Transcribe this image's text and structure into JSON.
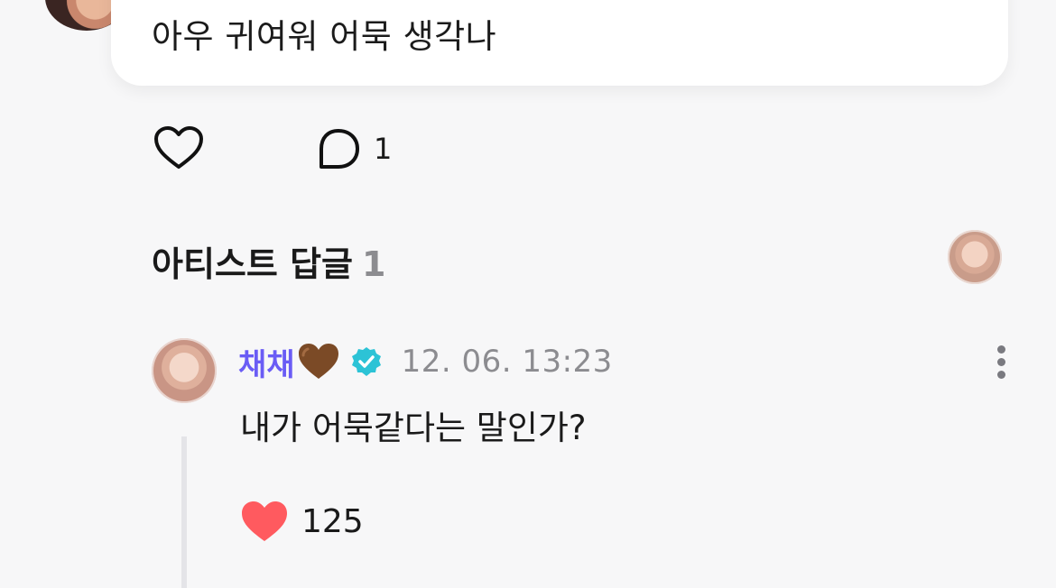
{
  "top_comment": {
    "text": "아우 귀여워 어묵 생각나"
  },
  "actions": {
    "comment_count": "1"
  },
  "artist_replies": {
    "title": "아티스트 답글",
    "count": "1"
  },
  "reply": {
    "author": "채채",
    "timestamp": "12. 06. 13:23",
    "text": "내가 어묵같다는 말인가?",
    "like_count": "125"
  },
  "colors": {
    "author": "#6a5cf5",
    "verified_badge": "#2cc3d6",
    "liked_heart": "#ff5a5f",
    "muted_text": "#8c8c90"
  },
  "icons": {
    "like": "heart-outline-icon",
    "comment": "speech-bubble-icon",
    "verified": "verified-badge-icon",
    "more": "vertical-dots-icon",
    "liked": "heart-filled-icon"
  }
}
